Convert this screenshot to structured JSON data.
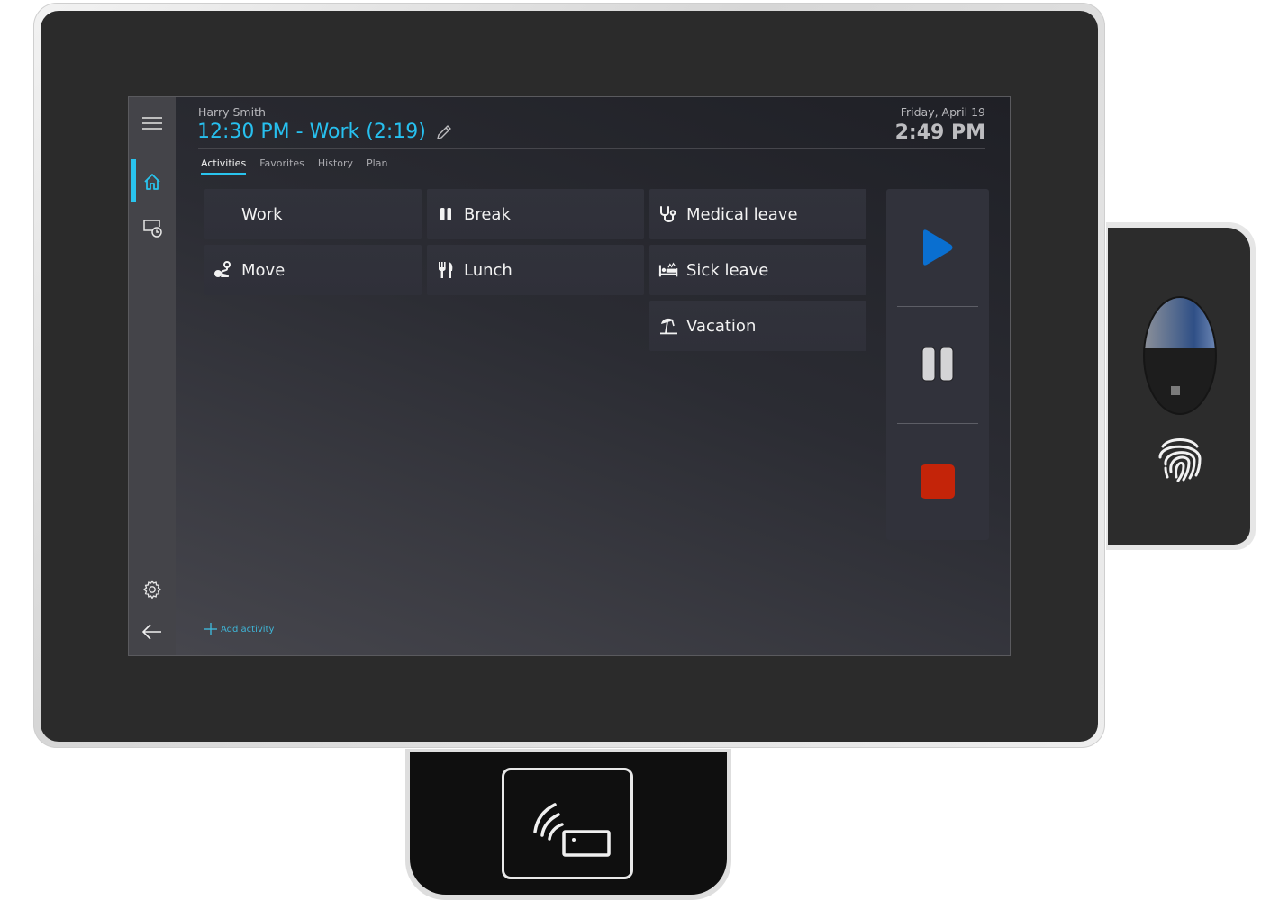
{
  "device": {
    "camera": "camera-sensor",
    "fingerprint": "fingerprint-icon",
    "nfc": "nfc-card-reader-icon"
  },
  "sidebar": {
    "items": [
      {
        "name": "menu",
        "icon": "hamburger-menu-icon"
      },
      {
        "name": "home",
        "icon": "home-icon",
        "active": true
      },
      {
        "name": "timesheet",
        "icon": "monitor-clock-icon"
      },
      {
        "name": "settings",
        "icon": "gear-icon"
      },
      {
        "name": "back",
        "icon": "arrow-left-icon"
      }
    ],
    "accent": "#29c4ee"
  },
  "header": {
    "user_name": "Harry Smith",
    "status": "12:30 PM - Work (2:19)",
    "date": "Friday, April 19",
    "time": "2:49 PM",
    "accent": "#27c0ef"
  },
  "tabs": [
    {
      "label": "Activities",
      "active": true
    },
    {
      "label": "Favorites"
    },
    {
      "label": "History"
    },
    {
      "label": "Plan"
    }
  ],
  "activities": [
    {
      "label": "Work",
      "icon": "none"
    },
    {
      "label": "Break",
      "icon": "pause-icon"
    },
    {
      "label": "Medical leave",
      "icon": "stethoscope-icon"
    },
    {
      "label": "Move",
      "icon": "route-icon"
    },
    {
      "label": "Lunch",
      "icon": "fork-knife-icon"
    },
    {
      "label": "Sick leave",
      "icon": "sick-bed-icon"
    },
    {
      "label": "Vacation",
      "icon": "beach-umbrella-icon"
    }
  ],
  "controls": {
    "play": {
      "icon": "play-icon",
      "color": "#0a6fd0"
    },
    "pause": {
      "icon": "pause-icon",
      "color": "#d4d4d6"
    },
    "stop": {
      "icon": "stop-icon",
      "color": "#c42409"
    }
  },
  "footer": {
    "add_activity": "Add activity"
  }
}
